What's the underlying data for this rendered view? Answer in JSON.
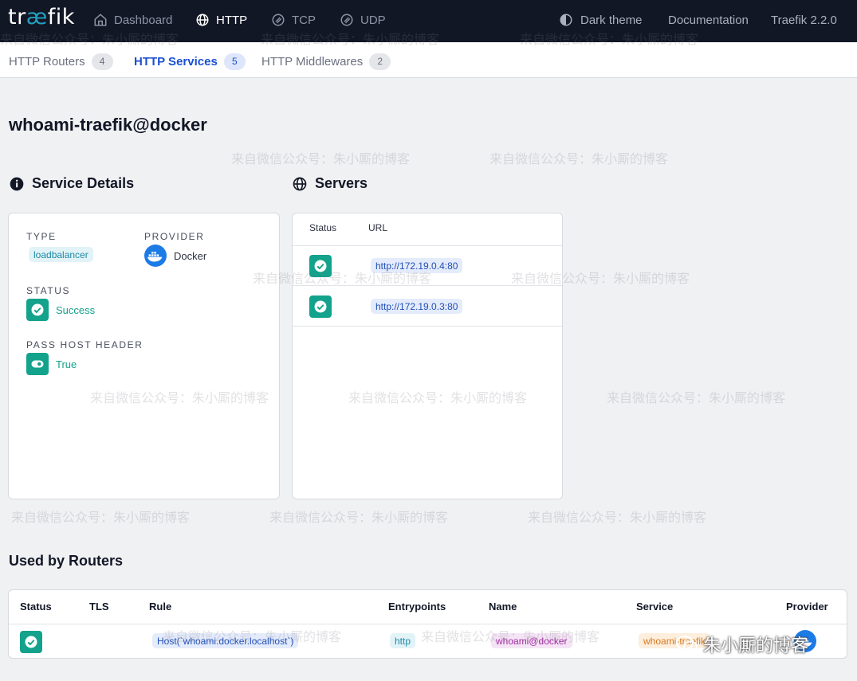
{
  "nav": {
    "logo_prefix": "tr",
    "logo_ae": "æ",
    "logo_suffix": "fik",
    "items": [
      {
        "label": "Dashboard",
        "icon": "home-icon"
      },
      {
        "label": "HTTP",
        "icon": "globe-icon",
        "active": true
      },
      {
        "label": "TCP",
        "icon": "tcp-icon"
      },
      {
        "label": "UDP",
        "icon": "udp-icon"
      }
    ],
    "theme_label": "Dark theme",
    "docs_label": "Documentation",
    "version_label": "Traefik 2.2.0"
  },
  "subtabs": [
    {
      "label": "HTTP Routers",
      "count": "4"
    },
    {
      "label": "HTTP Services",
      "count": "5",
      "active": true
    },
    {
      "label": "HTTP Middlewares",
      "count": "2"
    }
  ],
  "service": {
    "name": "whoami-traefik@docker"
  },
  "details": {
    "heading": "Service Details",
    "type_label": "TYPE",
    "type_value": "loadbalancer",
    "provider_label": "PROVIDER",
    "provider_value": "Docker",
    "status_label": "STATUS",
    "status_value": "Success",
    "pass_host_label": "PASS HOST HEADER",
    "pass_host_value": "True"
  },
  "servers": {
    "heading": "Servers",
    "col_status": "Status",
    "col_url": "URL",
    "rows": [
      {
        "url": "http://172.19.0.4:80"
      },
      {
        "url": "http://172.19.0.3:80"
      }
    ]
  },
  "routers": {
    "heading": "Used by Routers",
    "columns": [
      "Status",
      "TLS",
      "Rule",
      "Entrypoints",
      "Name",
      "Service",
      "Provider"
    ],
    "rows": [
      {
        "rule": "Host(`whoami.docker.localhost`)",
        "entrypoints": "http",
        "name": "whoami@docker",
        "service": "whoami-traefik"
      }
    ]
  },
  "watermark": "来自微信公众号：朱小厮的博客",
  "watermark_logo": "朱小厮的博客",
  "colors": {
    "nav_bg": "#121726",
    "accent_blue": "#1a50d0",
    "success_green": "#13a28b",
    "page_bg": "#f0f1f3"
  }
}
